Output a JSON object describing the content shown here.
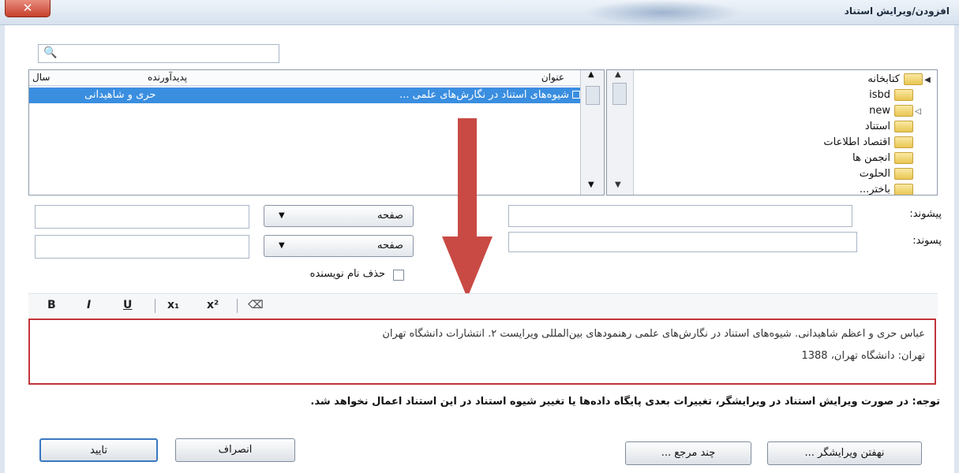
{
  "window": {
    "title": "افزودن/ویرایش استناد",
    "close_glyph": "✕"
  },
  "search": {
    "placeholder": ""
  },
  "tree": {
    "items": [
      {
        "label": "کتابخانه",
        "expander": "◀"
      },
      {
        "label": "isbd",
        "expander": ""
      },
      {
        "label": "new",
        "expander": "◁"
      },
      {
        "label": "استناد",
        "expander": ""
      },
      {
        "label": "اقتصاد اطلاعات",
        "expander": ""
      },
      {
        "label": "انجمن ها",
        "expander": ""
      },
      {
        "label": "الحلوت",
        "expander": ""
      },
      {
        "label": "باختر...",
        "expander": ""
      }
    ]
  },
  "list": {
    "columns": {
      "title": "عنوان",
      "author": "پدیدآورنده",
      "year": "سال"
    },
    "row": {
      "title": "شیوه‌های استناد در نگارش‌های علمی ...",
      "author": "حری و شاهیدانی",
      "year": ""
    }
  },
  "fields": {
    "prefix_label": "پیشوند:",
    "suffix_label": "پسوند:",
    "page_dropdown_1": "صفحه",
    "page_dropdown_2": "صفحه",
    "omit_author_label": "حذف نام نویسنده"
  },
  "editor_toolbar": {
    "bold": "B",
    "italic": "I",
    "underline": "U",
    "subscript": "x₁",
    "superscript": "x²"
  },
  "editor": {
    "line1": "عباس حری و اعظم شاهیدانی. شیوه‌های استناد در نگارش‌های علمی رهنمودهای بین‌المللی ویرایست ۲. انتشارات دانشگاه تهران",
    "line2": "تهران: دانشگاه تهران، 1388"
  },
  "note": "توجه: در صورت ویرایش استناد در ویرایشگر، تغییرات بعدی پایگاه داده‌ها یا تغییر شیوه استناد در این استناد اعمال نخواهد شد.",
  "buttons": {
    "hide_editor": "نهفتن ویرایشگر ...",
    "multiple_refs": "چند مرجع ...",
    "cancel": "انصراف",
    "ok": "تایید"
  },
  "colors": {
    "selection": "#3a8ee0",
    "highlight_border": "#c0343a",
    "arrow": "#c94a44"
  }
}
